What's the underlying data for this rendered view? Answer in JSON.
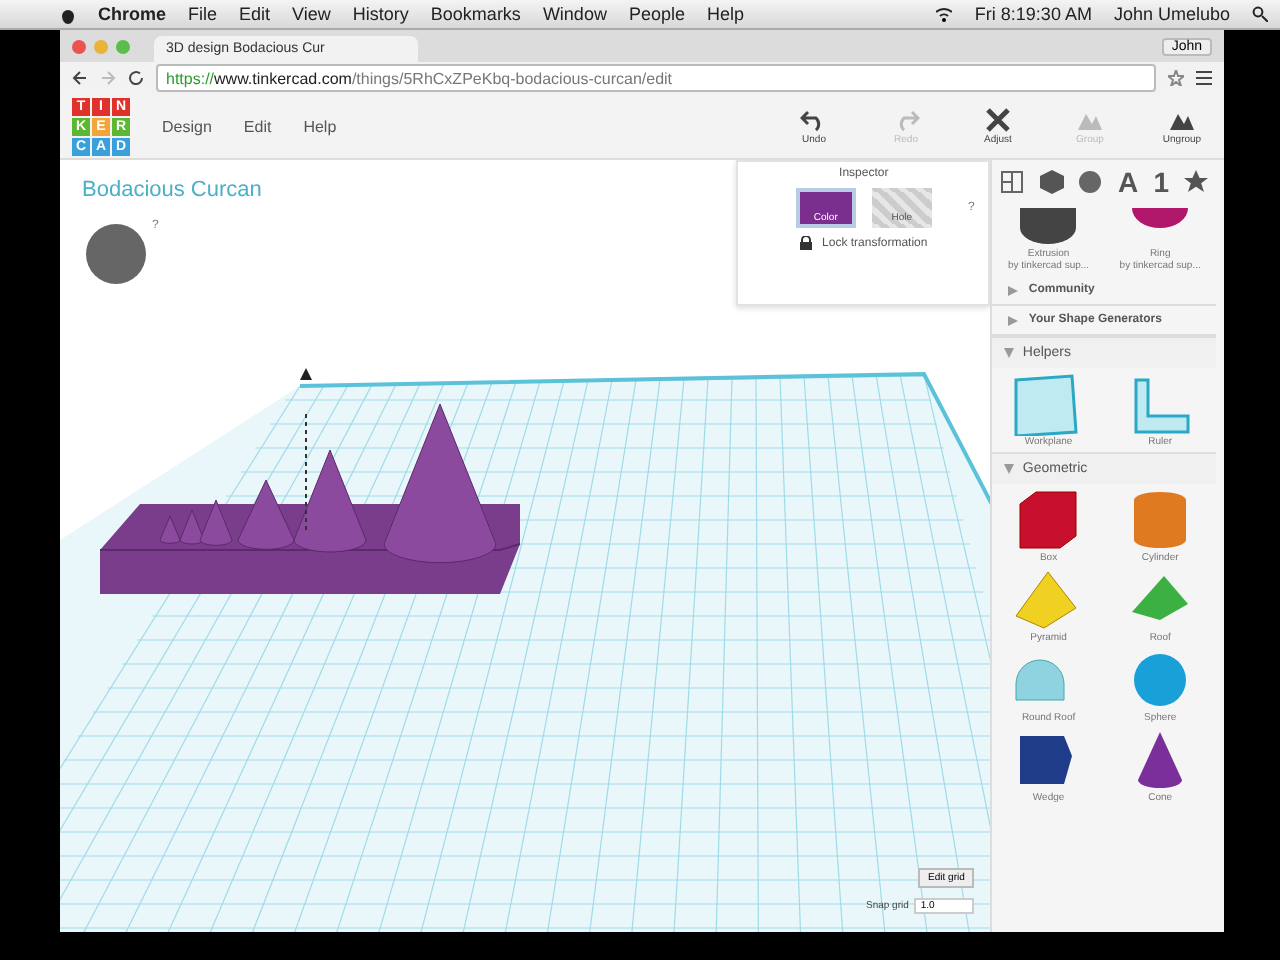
{
  "menubar": {
    "app": "Chrome",
    "menus": [
      "File",
      "Edit",
      "View",
      "History",
      "Bookmarks",
      "Window",
      "People",
      "Help"
    ],
    "clock": "Fri 8:19:30 AM",
    "user": "John Umelubo"
  },
  "browser": {
    "tab_title": "3D design Bodacious Cur",
    "profile": "John",
    "url_scheme": "https://",
    "url_host": "www.tinkercad.com",
    "url_path": "/things/5RhCxZPeKbq-bodacious-curcan/edit"
  },
  "app": {
    "logo": [
      "T",
      "I",
      "N",
      "K",
      "E",
      "R",
      "C",
      "A",
      "D"
    ],
    "menu": [
      "Design",
      "Edit",
      "Help"
    ],
    "tools": [
      {
        "label": "Undo",
        "kind": "undo",
        "disabled": false
      },
      {
        "label": "Redo",
        "kind": "redo",
        "disabled": true
      },
      {
        "label": "Adjust",
        "kind": "adjust",
        "disabled": false
      },
      {
        "label": "Group",
        "kind": "group",
        "disabled": true
      },
      {
        "label": "Ungroup",
        "kind": "ungroup",
        "disabled": false
      }
    ],
    "design_title": "Bodacious Curcan",
    "nav_help": "?",
    "inspector": {
      "title": "Inspector",
      "help": "?",
      "swatches": [
        {
          "label": "Color",
          "kind": "solid",
          "selected": true
        },
        {
          "label": "Hole",
          "kind": "hole",
          "selected": false
        }
      ],
      "lock_label": "Lock transformation"
    },
    "edit_grid": "Edit grid",
    "snap_grid_label": "Snap grid",
    "snap_grid_value": "1.0"
  },
  "panel": {
    "tabs": [
      {
        "kind": "grid-icon"
      },
      {
        "kind": "box-icon"
      },
      {
        "kind": "badge-icon"
      },
      {
        "kind": "text",
        "label": "A"
      },
      {
        "kind": "text",
        "label": "1"
      },
      {
        "kind": "star-icon"
      }
    ],
    "sections": [
      {
        "kind": "shapes",
        "items": [
          {
            "name": "Extrusion",
            "author": "by tinkercad sup...",
            "kind": "extrusion"
          },
          {
            "name": "Ring",
            "author": "by tinkercad sup...",
            "kind": "ring"
          }
        ]
      },
      {
        "kind": "link",
        "label": "Community",
        "expanded": false
      },
      {
        "kind": "link",
        "label": "Your Shape Generators",
        "expanded": false
      },
      {
        "kind": "group",
        "label": "Helpers",
        "expanded": true,
        "items": [
          {
            "name": "Workplane",
            "kind": "workplane"
          },
          {
            "name": "Ruler",
            "kind": "ruler"
          }
        ]
      },
      {
        "kind": "group",
        "label": "Geometric",
        "expanded": true,
        "items": [
          {
            "name": "Box",
            "kind": "box"
          },
          {
            "name": "Cylinder",
            "kind": "cylinder"
          },
          {
            "name": "Pyramid",
            "kind": "pyramid"
          },
          {
            "name": "Roof",
            "kind": "roof"
          },
          {
            "name": "Round Roof",
            "kind": "round-roof"
          },
          {
            "name": "Sphere",
            "kind": "sphere"
          },
          {
            "name": "Wedge",
            "kind": "wedge"
          },
          {
            "name": "Cone",
            "kind": "cone"
          }
        ]
      }
    ]
  }
}
